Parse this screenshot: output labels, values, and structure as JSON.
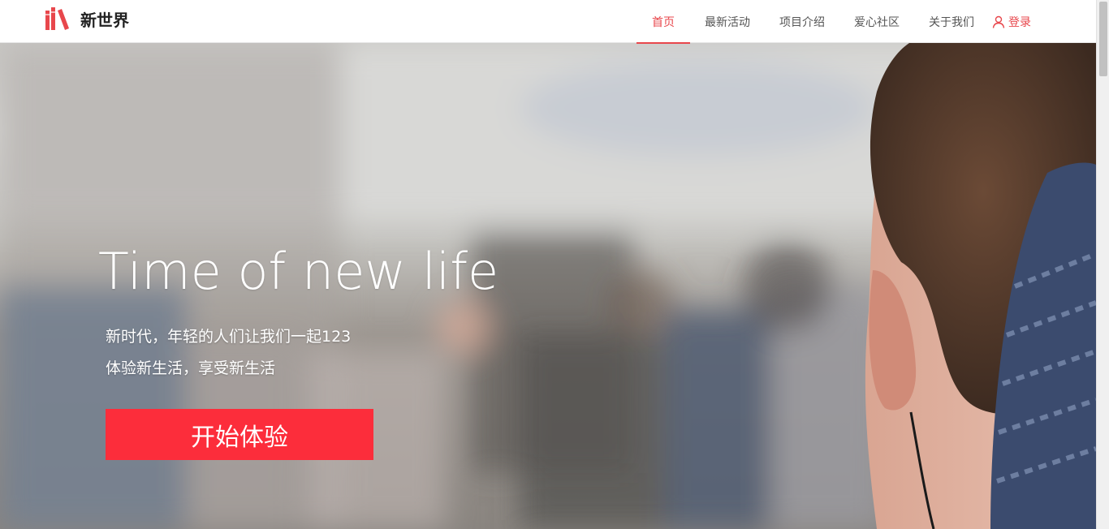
{
  "brand": {
    "name": "新世界",
    "icon": "books-icon",
    "accent_color": "#e8474c"
  },
  "nav": {
    "items": [
      {
        "label": "首页",
        "active": true
      },
      {
        "label": "最新活动",
        "active": false
      },
      {
        "label": "项目介绍",
        "active": false
      },
      {
        "label": "爱心社区",
        "active": false
      },
      {
        "label": "关于我们",
        "active": false
      }
    ],
    "login": {
      "label": "登录",
      "icon": "user-icon"
    }
  },
  "hero": {
    "title": "Time of new life",
    "subtitle_line1": "新时代，年轻的人们让我们一起123",
    "subtitle_line2": "体验新生活，享受新生活",
    "cta_label": "开始体验",
    "cta_color": "#fc2d3b"
  }
}
